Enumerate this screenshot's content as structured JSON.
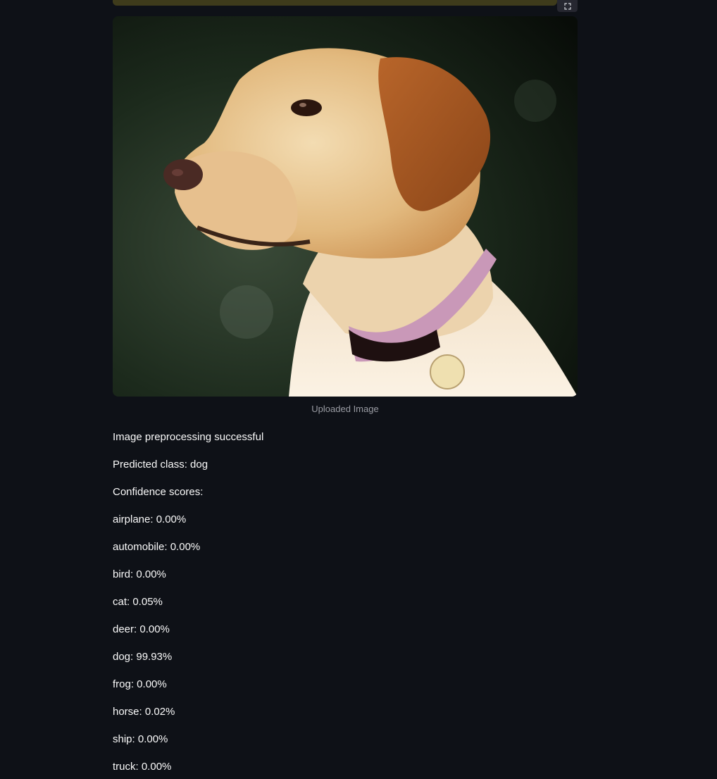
{
  "image": {
    "caption": "Uploaded Image",
    "alt": "Uploaded Image"
  },
  "icons": {
    "fullscreen": "fullscreen-icon"
  },
  "results": {
    "status": "Image preprocessing successful",
    "predicted": "Predicted class: dog",
    "confidence_header": "Confidence scores:",
    "scores": [
      "airplane: 0.00%",
      "automobile: 0.00%",
      "bird: 0.00%",
      "cat: 0.05%",
      "deer: 0.00%",
      "dog: 99.93%",
      "frog: 0.00%",
      "horse: 0.02%",
      "ship: 0.00%",
      "truck: 0.00%"
    ]
  },
  "colors": {
    "background": "#0e1117",
    "text": "#fafafa",
    "caption": "#9a9ca3",
    "top_bar": "#3e3b1b"
  }
}
